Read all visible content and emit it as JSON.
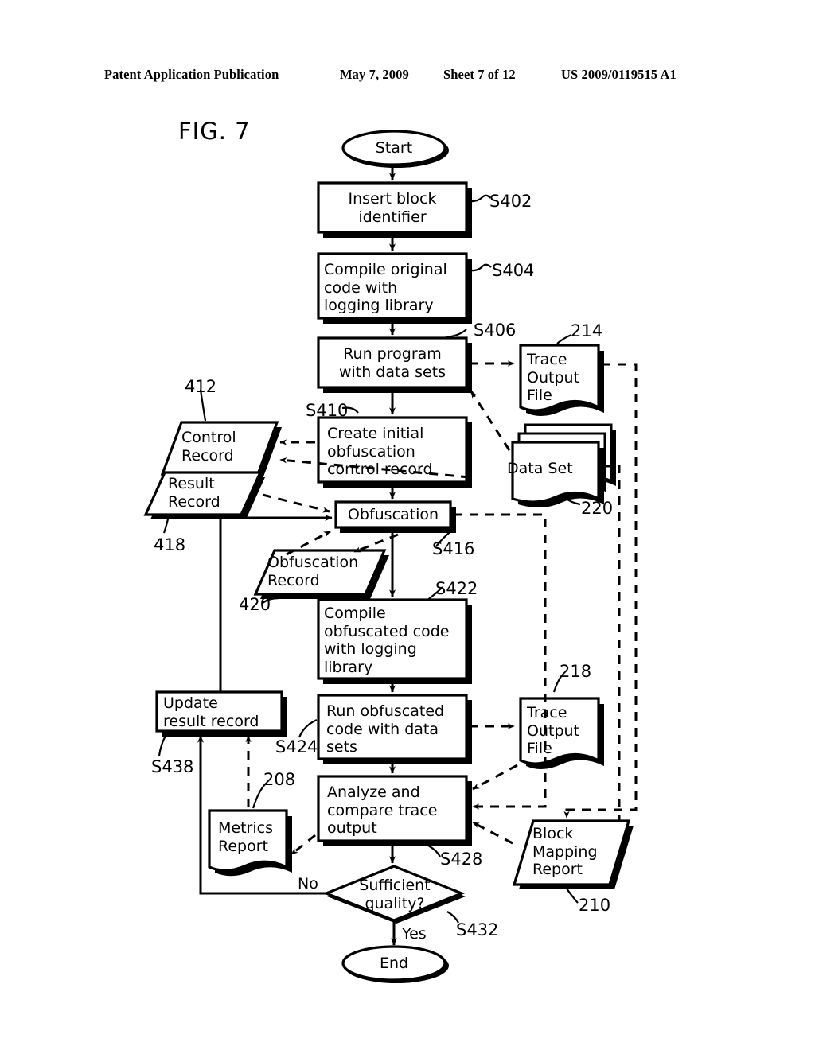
{
  "header": {
    "publication": "Patent Application Publication",
    "date": "May 7, 2009",
    "sheet": "Sheet 7 of 12",
    "docnum": "US 2009/0119515 A1"
  },
  "figure": {
    "label": "FIG. 7"
  },
  "nodes": {
    "start": {
      "label": "Start",
      "shape": "terminator"
    },
    "insert_block": {
      "label": "Insert block\nidentifier",
      "shape": "process",
      "ref": "S402"
    },
    "compile_original": {
      "label": "Compile original\ncode with\nlogging library",
      "shape": "process",
      "ref": "S404"
    },
    "run_program": {
      "label": "Run program\nwith data sets",
      "shape": "process",
      "ref": "S406"
    },
    "create_initial": {
      "label": "Create initial\nobfuscation\ncontrol record",
      "shape": "process",
      "ref": "S410"
    },
    "obfuscation": {
      "label": "Obfuscation",
      "shape": "process",
      "ref": "S416"
    },
    "compile_obf": {
      "label": "Compile\nobfuscated code\nwith logging\nlibrary",
      "shape": "process",
      "ref": "S422"
    },
    "run_obf": {
      "label": "Run obfuscated\ncode with data\nsets",
      "shape": "process",
      "ref": "S424"
    },
    "analyze": {
      "label": "Analyze and\ncompare trace\noutput",
      "shape": "process",
      "ref": "S428"
    },
    "decision": {
      "label": "Sufficient\nquality?",
      "shape": "decision",
      "ref": "S432"
    },
    "end": {
      "label": "End",
      "shape": "terminator"
    },
    "update_result": {
      "label": "Update\nresult record",
      "shape": "process",
      "ref": "S438"
    },
    "control_record": {
      "label": "Control\nRecord",
      "shape": "parallelogram",
      "ref": "412"
    },
    "result_record": {
      "label": "Result\nRecord",
      "shape": "parallelogram",
      "ref": "418"
    },
    "obfuscation_record": {
      "label": "Obfuscation\nRecord",
      "shape": "parallelogram",
      "ref": "420"
    },
    "block_mapping": {
      "label": "Block\nMapping\nReport",
      "shape": "parallelogram",
      "ref": "210"
    },
    "trace_214": {
      "label": "Trace\nOutput\nFile",
      "shape": "document",
      "ref": "214"
    },
    "trace_218": {
      "label": "Trace\nOutput\nFile",
      "shape": "document",
      "ref": "218"
    },
    "data_set": {
      "label": "Data Set",
      "shape": "multidocument",
      "ref": "220"
    },
    "metrics_report": {
      "label": "Metrics\nReport",
      "shape": "document",
      "ref": "208"
    }
  },
  "edge_labels": {
    "no": "No",
    "yes": "Yes"
  },
  "colors": {
    "ink": "#000000",
    "paper": "#ffffff"
  }
}
